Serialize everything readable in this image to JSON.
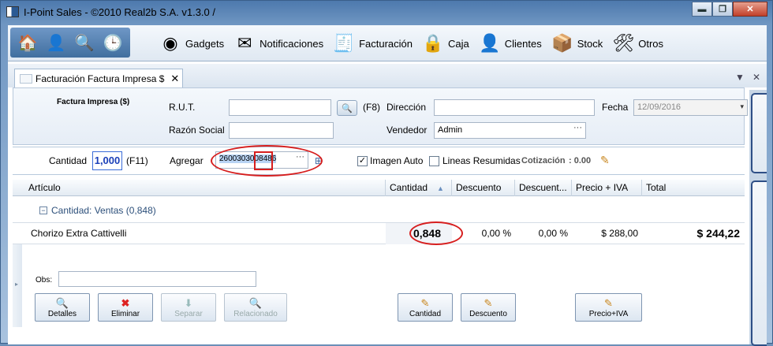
{
  "window": {
    "title": "I-Point Sales  - ©2010 Real2b S.A. v1.3.0 /",
    "buttons": {
      "minimize": "▬",
      "maximize": "❐",
      "close": "✕"
    }
  },
  "toolbar": {
    "quick_icons": [
      "home-icon",
      "user-icon",
      "search-icon",
      "clock-icon"
    ],
    "items": [
      {
        "label": "Gadgets",
        "icon": "gauge-icon"
      },
      {
        "label": "Notificaciones",
        "icon": "envelope-icon"
      },
      {
        "label": "Facturación",
        "icon": "cash-register-icon"
      },
      {
        "label": "Caja",
        "icon": "safe-icon"
      },
      {
        "label": "Clientes",
        "icon": "person-icon"
      },
      {
        "label": "Stock",
        "icon": "boxes-icon"
      },
      {
        "label": "Otros",
        "icon": "tools-icon"
      }
    ]
  },
  "tab": {
    "label": "Facturación Factura Impresa $",
    "close": "✕"
  },
  "form": {
    "title": "Factura Impresa ($)",
    "rut_label": "R.U.T.",
    "rut_value": "",
    "f8": "(F8)",
    "direccion_label": "Dirección",
    "direccion_value": "",
    "fecha_label": "Fecha",
    "fecha_value": "12/09/2016",
    "razon_label": "Razón Social",
    "razon_value": "",
    "vendedor_label": "Vendedor",
    "vendedor_value": "Admin",
    "ellipsis": "···"
  },
  "entry": {
    "cantidad_label": "Cantidad",
    "cantidad_value": "1,000",
    "f11": "(F11)",
    "agregar_label": "Agregar",
    "agregar_value": "2600303008486",
    "imagen_auto_label": "Imagen Auto",
    "imagen_auto_checked": true,
    "lineas_label": "Lineas Resumidas",
    "lineas_checked": false,
    "cotizacion_label": "Cotización",
    "cotizacion_value": ": 0.00"
  },
  "grid": {
    "columns": [
      "Artículo",
      "Cantidad",
      "Descuento",
      "Descuent...",
      "Precio + IVA",
      "Total"
    ],
    "group_label": "Cantidad: Ventas (0,848)",
    "row": {
      "articulo": "Chorizo Extra Cattivelli",
      "cantidad": "0,848",
      "descuento": "0,00 %",
      "descuento2": "0,00 %",
      "precio": "$ 288,00",
      "total": "$ 244,22"
    },
    "obs_label": "Obs:",
    "obs_value": "",
    "actions": {
      "detalles": "Detalles",
      "eliminar": "Eliminar",
      "separar": "Separar",
      "relacionado": "Relacionado",
      "cantidad": "Cantidad",
      "descuento": "Descuento",
      "precio": "Precio+IVA"
    }
  }
}
